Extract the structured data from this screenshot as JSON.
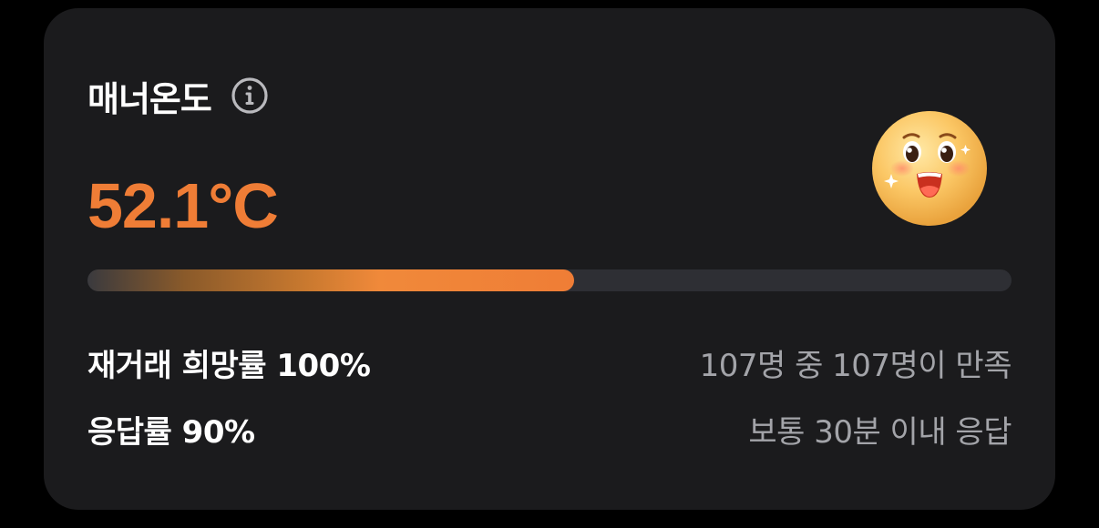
{
  "card": {
    "title": "매너온도",
    "info_icon": "info-circle-icon",
    "temperature": "52.1°C",
    "temperature_color": "#ef7d36",
    "emoji_icon": "happy-face-emoji-icon",
    "progress_fraction": 0.527
  },
  "stats": [
    {
      "label": "재거래 희망률 100%",
      "detail": "107명 중 107명이 만족"
    },
    {
      "label": "응답률 90%",
      "detail": "보통 30분 이내 응답"
    }
  ]
}
